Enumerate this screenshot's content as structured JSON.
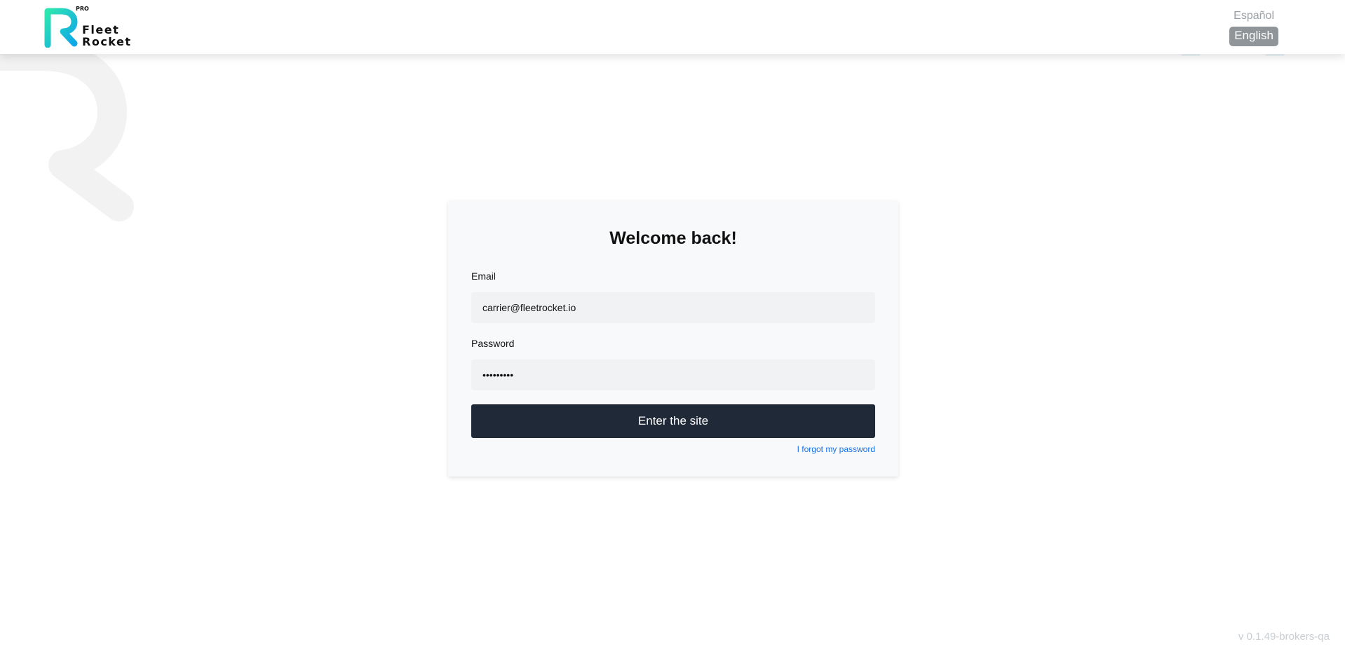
{
  "brand": {
    "badge": "PRO",
    "name_line1": "Fleet",
    "name_line2": "Rocket",
    "gradient_start": "#2ee6b0",
    "gradient_end": "#0ea5e9"
  },
  "language": {
    "options": [
      "Español",
      "English"
    ],
    "selected": "English"
  },
  "login": {
    "title": "Welcome back!",
    "email_label": "Email",
    "email_value": "carrier@fleetrocket.io",
    "password_label": "Password",
    "password_value": "123456789",
    "submit_label": "Enter the site",
    "forgot_label": "I forgot my password"
  },
  "footer": {
    "version": "v 0.1.49-brokers-qa"
  },
  "colors": {
    "button_bg": "#1f2937",
    "link": "#1a73e8",
    "card_bg": "#f8f9fa",
    "input_bg": "#f1f2f4"
  }
}
